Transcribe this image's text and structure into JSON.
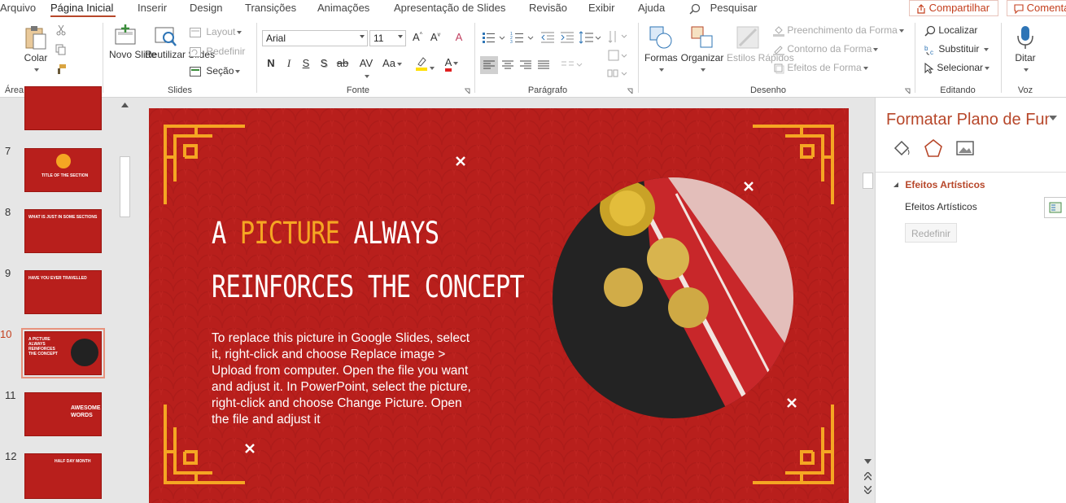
{
  "tabs": [
    "Arquivo",
    "Página Inicial",
    "Inserir",
    "Design",
    "Transições",
    "Animações",
    "Apresentação de Slides",
    "Revisão",
    "Exibir",
    "Ajuda"
  ],
  "active_tab": "Página Inicial",
  "search_label": "Pesquisar",
  "share_label": "Compartilhar",
  "comments_label": "Comentários",
  "ribbon": {
    "clipboard": {
      "paste": "Colar",
      "group": "Área de Transferência"
    },
    "slides": {
      "new_slide": "Novo Slide",
      "reuse_slides": "Reutilizar Slides",
      "layout": "Layout",
      "reset": "Redefinir",
      "section": "Seção",
      "group": "Slides"
    },
    "font": {
      "font_name": "Arial",
      "font_size": "11",
      "group": "Fonte"
    },
    "paragraph": {
      "group": "Parágrafo"
    },
    "drawing": {
      "shapes": "Formas",
      "arrange": "Organizar",
      "quick_styles": "Estilos Rápidos",
      "shape_fill": "Preenchimento da Forma",
      "shape_outline": "Contorno da Forma",
      "shape_effects": "Efeitos de Forma",
      "group": "Desenho"
    },
    "editing": {
      "find": "Localizar",
      "replace": "Substituir",
      "select": "Selecionar",
      "group": "Editando"
    },
    "voice": {
      "dictate": "Ditar",
      "group": "Voz"
    }
  },
  "thumbnails": [
    {
      "num": "7",
      "text": "TITLE OF THE SECTION"
    },
    {
      "num": "8",
      "text": "WHAT IS JUST IN SOME SECTIONS"
    },
    {
      "num": "9",
      "text": "HAVE YOU EVER TRAVELLED"
    },
    {
      "num": "10",
      "text": "A PICTURE ALWAYS REINFORCES THE CONCEPT"
    },
    {
      "num": "11",
      "text": "AWESOME WORDS"
    },
    {
      "num": "12",
      "text": "HALF DAY MONTH"
    }
  ],
  "selected_thumbnail": "10",
  "slide": {
    "title_line1_a": "A ",
    "title_line1_b": "PICTURE",
    "title_line1_c": " ALWAYS",
    "title_line2": "REINFORCES THE CONCEPT",
    "body": "To replace this picture in Google Slides, select it, right-click and choose Replace image > Upload from computer. Open the file you want and adjust it. In PowerPoint, select the picture, right-click and choose Change Picture. Open the file and adjust it"
  },
  "pane": {
    "title": "Formatar Plano de Fundo",
    "section": "Efeitos Artísticos",
    "row_label": "Efeitos Artísticos",
    "reset": "Redefinir"
  },
  "colors": {
    "accent": "#b7472a",
    "slide_bg": "#b81f1c",
    "gold": "#f5a623"
  }
}
